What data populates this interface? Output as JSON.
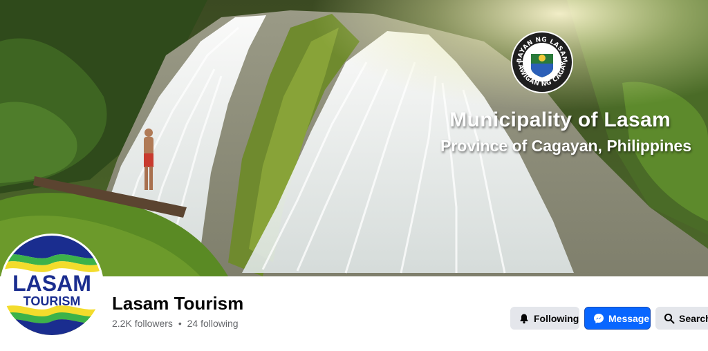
{
  "cover": {
    "title": "Municipality of Lasam",
    "subtitle": "Province of Cagayan, Philippines",
    "seal": {
      "top_text": "BAYAN NG LASAM",
      "bottom_text": "LALAWIGAN NG CAGAYAN"
    }
  },
  "profile": {
    "avatar": {
      "line1": "LASAM",
      "line2": "TOURISM"
    },
    "name": "Lasam Tourism",
    "followers": "2.2K followers",
    "separator": "•",
    "following": "24 following"
  },
  "actions": {
    "following_label": "Following",
    "message_label": "Message",
    "search_label": "Search"
  },
  "colors": {
    "message_button": "#0866ff",
    "secondary_button": "#e4e6eb",
    "text_primary": "#050505",
    "text_secondary": "#65676b",
    "avatar_navy": "#1a2d8f",
    "avatar_yellow": "#f3dc2c",
    "avatar_green": "#3cb24a"
  },
  "icons": {
    "following": "bell-icon",
    "message": "messenger-icon",
    "search": "search-icon"
  }
}
